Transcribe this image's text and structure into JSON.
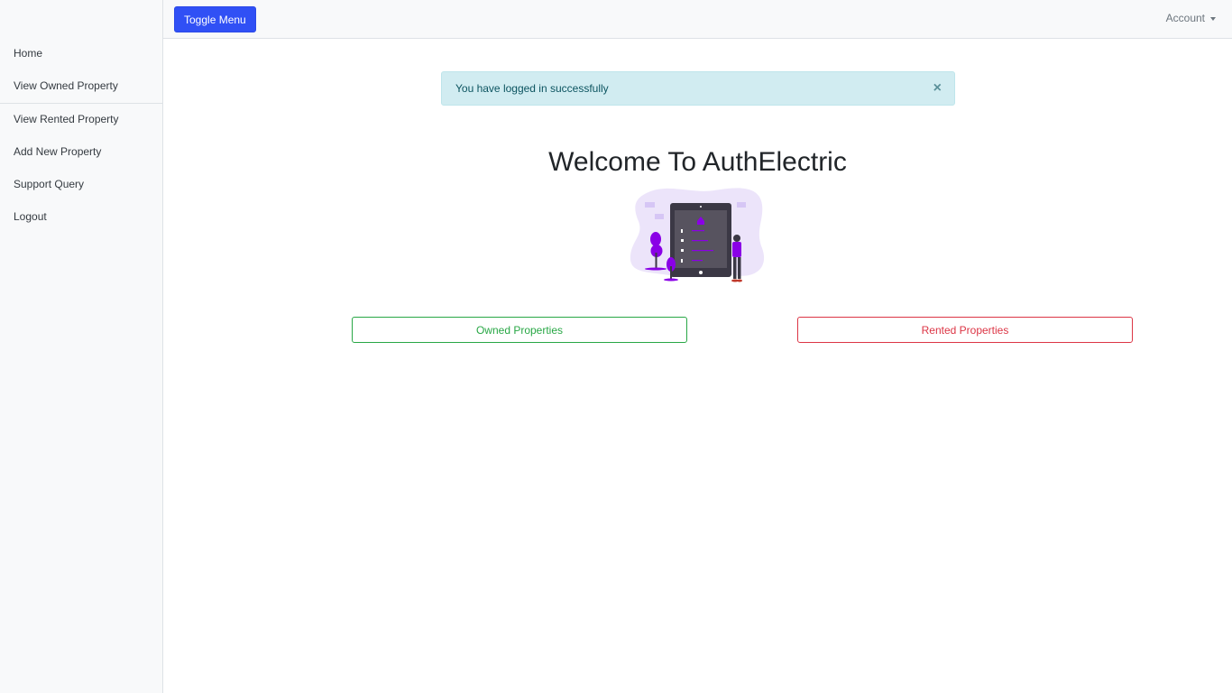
{
  "sidebar": {
    "items": [
      {
        "label": "Home"
      },
      {
        "label": "View Owned Property"
      },
      {
        "label": "View Rented Property"
      },
      {
        "label": "Add New Property"
      },
      {
        "label": "Support Query"
      },
      {
        "label": "Logout"
      }
    ]
  },
  "topbar": {
    "toggle_label": "Toggle Menu",
    "account_label": "Account"
  },
  "alert": {
    "message": "You have logged in successfully",
    "close_symbol": "×"
  },
  "main": {
    "title": "Welcome To AuthElectric",
    "illustration_icon": "tablet-person-illustration",
    "owned_button": "Owned Properties",
    "rented_button": "Rented Properties"
  },
  "colors": {
    "primary": "#3050f5",
    "success": "#28a745",
    "danger": "#dc3545",
    "info_bg": "#d1ecf1",
    "illustration_accent": "#8a00e6"
  }
}
